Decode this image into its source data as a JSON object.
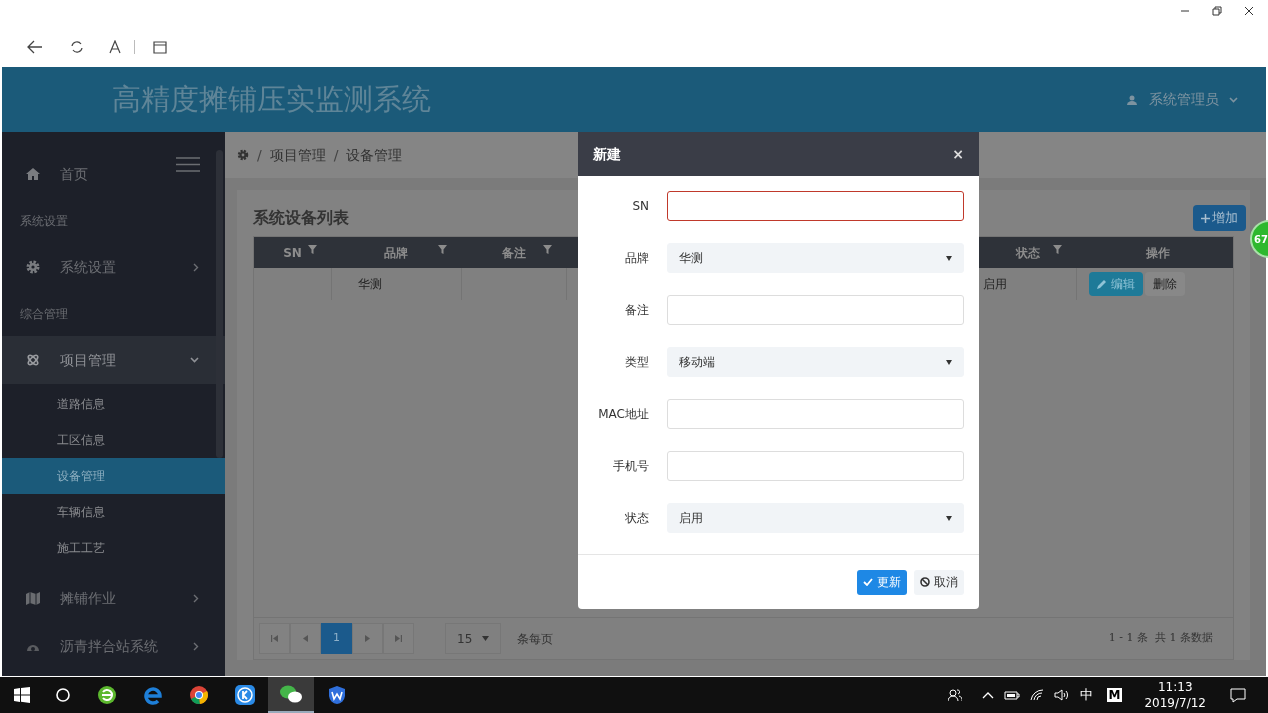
{
  "app": {
    "title": "高精度摊铺压实监测系统",
    "user": "系统管理员"
  },
  "sidebar": {
    "items": [
      {
        "kind": "link",
        "label": "首页"
      },
      {
        "kind": "section",
        "label": "系统设置"
      },
      {
        "kind": "menu",
        "label": "系统设置",
        "expanded": false
      },
      {
        "kind": "section",
        "label": "综合管理"
      },
      {
        "kind": "menu",
        "label": "项目管理",
        "expanded": true,
        "children": [
          {
            "label": "道路信息",
            "selected": false
          },
          {
            "label": "工区信息",
            "selected": false
          },
          {
            "label": "设备管理",
            "selected": true
          },
          {
            "label": "车辆信息",
            "selected": false
          },
          {
            "label": "施工工艺",
            "selected": false
          }
        ]
      },
      {
        "kind": "menu",
        "label": "摊铺作业",
        "expanded": false
      },
      {
        "kind": "menu",
        "label": "沥青拌合站系统",
        "expanded": false
      }
    ]
  },
  "breadcrumb": {
    "separator": "/",
    "items": [
      "项目管理",
      "设备管理"
    ]
  },
  "panel": {
    "title": "系统设备列表",
    "add_button": "增加"
  },
  "table": {
    "columns": [
      {
        "label": "SN",
        "filter": true
      },
      {
        "label": "品牌",
        "filter": true
      },
      {
        "label": "备注",
        "filter": true
      },
      {
        "label": "状态",
        "filter": true
      },
      {
        "label": "操作",
        "filter": false
      }
    ],
    "rows": [
      {
        "brand": "华测",
        "status": "启用",
        "actions": [
          {
            "label": "编辑",
            "kind": "primary"
          },
          {
            "label": "删除",
            "kind": "plain"
          }
        ]
      }
    ]
  },
  "pagination": {
    "pages": [
      {
        "label": "1",
        "selected": true
      }
    ],
    "page_size": "15",
    "page_size_label": "条每页",
    "summary": "1 - 1 条  共 1 条数据"
  },
  "dialog": {
    "title": "新建",
    "close": "×",
    "fields": [
      {
        "label": "SN",
        "kind": "input",
        "invalid": true
      },
      {
        "label": "品牌",
        "kind": "select",
        "value": "华测",
        "invalid": false
      },
      {
        "label": "备注",
        "kind": "input",
        "invalid": false
      },
      {
        "label": "类型",
        "kind": "select",
        "value": "移动端",
        "invalid": false
      },
      {
        "label": "MAC地址",
        "kind": "input",
        "invalid": false
      },
      {
        "label": "手机号",
        "kind": "input",
        "invalid": false
      },
      {
        "label": "状态",
        "kind": "select",
        "value": "启用",
        "invalid": false
      }
    ],
    "buttons": [
      {
        "label": "更新",
        "kind": "primary"
      },
      {
        "label": "取消",
        "kind": "secondary"
      }
    ]
  },
  "badge": {
    "text": "67"
  },
  "taskbar": {
    "apps": [
      {
        "active": false
      },
      {
        "active": false
      },
      {
        "active": false
      },
      {
        "active": false
      },
      {
        "active": true
      },
      {
        "active": false
      }
    ],
    "ime": "中",
    "ime_mode": "M",
    "time": "11:13",
    "date": "2019/7/12"
  }
}
